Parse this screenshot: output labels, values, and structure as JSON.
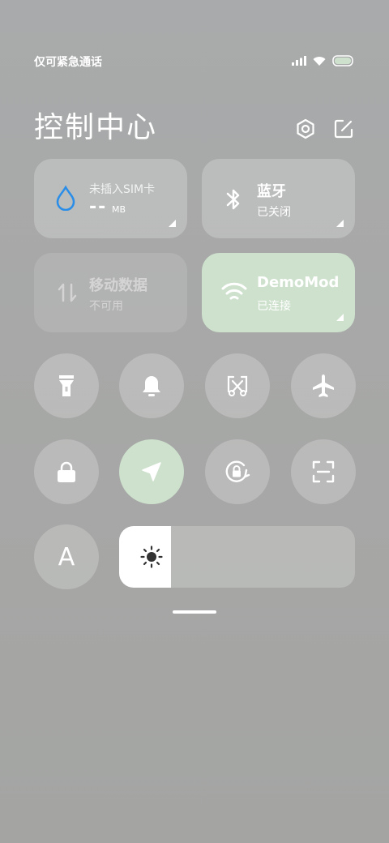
{
  "status": {
    "carrier_text": "仅可紧急通话"
  },
  "header": {
    "title": "控制中心"
  },
  "tiles": {
    "data_usage": {
      "title": "未插入SIM卡",
      "value": "--",
      "unit": "MB"
    },
    "bluetooth": {
      "title": "蓝牙",
      "status": "已关闭"
    },
    "mobile_data": {
      "title": "移动数据",
      "status": "不可用"
    },
    "wifi": {
      "title": "DemoMod",
      "status": "已连接"
    }
  },
  "toggles": {
    "font_label": "A"
  },
  "brightness": {
    "level": 0.22
  },
  "colors": {
    "accent_active": "#cde1cd",
    "tile_bg": "rgba(255,255,255,0.22)",
    "water_icon": "#2a8ee8"
  }
}
